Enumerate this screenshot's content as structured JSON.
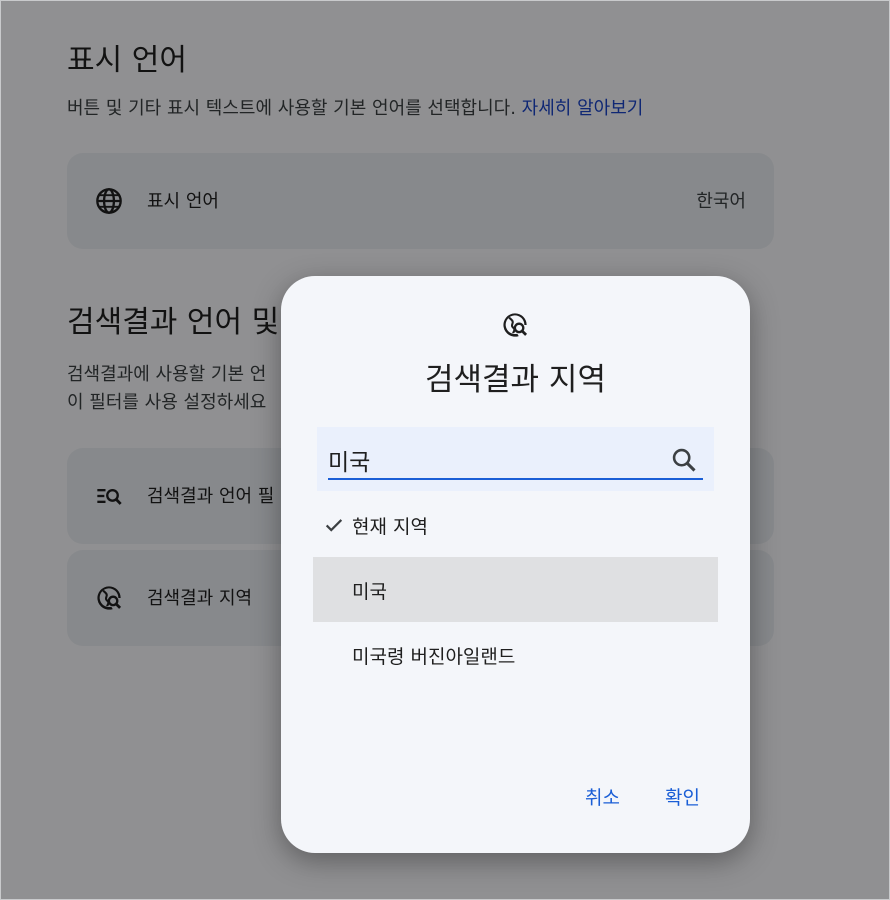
{
  "display_language": {
    "title": "표시 언어",
    "description": "버튼 및 기타 표시 텍스트에 사용할 기본 언어를 선택합니다.",
    "learn_more": "자세히 알아보기",
    "row_label": "표시 언어",
    "row_value": "한국어",
    "row_icon": "globe-icon"
  },
  "search_results": {
    "title": "검색결과 언어 및",
    "description_line1": "검색결과에 사용할 기본 언",
    "description_line2": "이 필터를 사용 설정하세요",
    "language_filter_label": "검색결과 언어 필",
    "language_filter_icon": "filter-search-icon",
    "region_label": "검색결과 지역",
    "region_icon": "globe-search-icon"
  },
  "dialog": {
    "icon": "globe-search-icon",
    "title": "검색결과 지역",
    "search_value": "미국",
    "search_icon": "search-icon",
    "options": [
      {
        "label": "현재 지역",
        "checked": true
      },
      {
        "label": "미국",
        "highlighted": true
      },
      {
        "label": "미국령 버진아일랜드"
      }
    ],
    "cancel_label": "취소",
    "ok_label": "확인"
  },
  "colors": {
    "accent": "#1a5ed6",
    "link": "#1a44c8",
    "card": "#e9ecf2",
    "dialog": "#f4f6fa"
  }
}
